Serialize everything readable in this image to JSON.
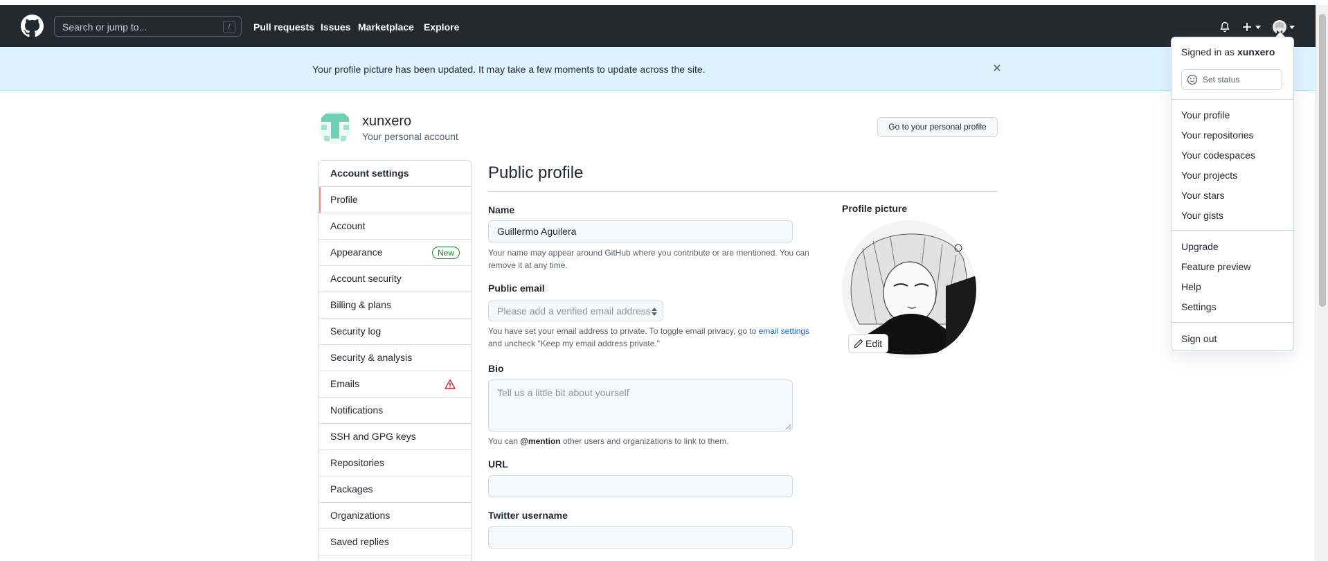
{
  "header": {
    "search_placeholder": "Search or jump to...",
    "search_shortcut": "/",
    "nav": [
      "Pull requests",
      "Issues",
      "Marketplace",
      "Explore"
    ]
  },
  "flash": {
    "message": "Your profile picture has been updated. It may take a few moments to update across the site."
  },
  "account": {
    "username": "xunxero",
    "subtitle": "Your personal account",
    "go_button": "Go to your personal profile"
  },
  "sidebar": {
    "heading": "Account settings",
    "items": [
      {
        "label": "Profile"
      },
      {
        "label": "Account"
      },
      {
        "label": "Appearance",
        "badge": "New"
      },
      {
        "label": "Account security"
      },
      {
        "label": "Billing & plans"
      },
      {
        "label": "Security log"
      },
      {
        "label": "Security & analysis"
      },
      {
        "label": "Emails"
      },
      {
        "label": "Notifications"
      },
      {
        "label": "SSH and GPG keys"
      },
      {
        "label": "Repositories"
      },
      {
        "label": "Packages"
      },
      {
        "label": "Organizations"
      },
      {
        "label": "Saved replies"
      }
    ]
  },
  "main": {
    "title": "Public profile",
    "name_label": "Name",
    "name_value": "Guillermo Aguilera",
    "name_note": "Your name may appear around GitHub where you contribute or are mentioned. You can remove it at any time.",
    "email_label": "Public email",
    "email_placeholder": "Please add a verified email address",
    "email_note_pre": "You have set your email address to private. To toggle email privacy, go to ",
    "email_note_link": "email settings",
    "email_note_post": " and uncheck \"Keep my email address private.\"",
    "bio_label": "Bio",
    "bio_placeholder": "Tell us a little bit about yourself",
    "bio_note_pre": "You can ",
    "bio_note_mention": "@mention",
    "bio_note_post": " other users and organizations to link to them.",
    "url_label": "URL",
    "url_value": "",
    "twitter_label": "Twitter username",
    "twitter_value": "",
    "picture_label": "Profile picture",
    "edit_button": "Edit"
  },
  "dropdown": {
    "signed_in_prefix": "Signed in as",
    "signed_in_user": "xunxero",
    "set_status": "Set status",
    "group1": [
      "Your profile",
      "Your repositories",
      "Your codespaces",
      "Your projects",
      "Your stars",
      "Your gists"
    ],
    "group2": [
      "Upgrade",
      "Feature preview",
      "Help",
      "Settings"
    ],
    "sign_out": "Sign out"
  },
  "colors": {
    "header_bg": "#24292f",
    "flash_bg": "#ddf4ff",
    "active_accent": "#fd8c73",
    "link": "#0969da",
    "badge_green": "#1a7f37",
    "warning_red": "#cf222e"
  },
  "icons": [
    "github-logo-icon",
    "bell-icon",
    "plus-icon",
    "caret-down-icon",
    "close-icon",
    "alert-icon",
    "smiley-icon",
    "pencil-icon",
    "select-arrows-icon"
  ]
}
